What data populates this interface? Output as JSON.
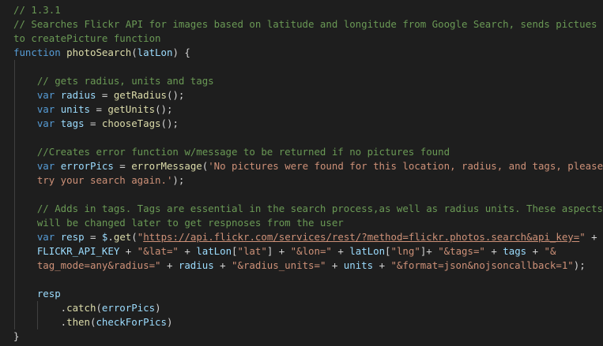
{
  "editor": {
    "lines": [
      {
        "tokens": [
          {
            "t": "cm",
            "v": "// 1.3.1"
          }
        ]
      },
      {
        "tokens": [
          {
            "t": "cm",
            "v": "// Searches Flickr API for images based on latitude and longitude from Google Search, sends pictues"
          }
        ]
      },
      {
        "tokens": [
          {
            "t": "cm",
            "v": "to createPicture function"
          }
        ]
      },
      {
        "tokens": [
          {
            "t": "kw",
            "v": "function "
          },
          {
            "t": "fn",
            "v": "photoSearch"
          },
          {
            "t": "pn",
            "v": "("
          },
          {
            "t": "vr",
            "v": "latLon"
          },
          {
            "t": "pn",
            "v": ") {"
          }
        ]
      },
      {
        "guides": 1,
        "tokens": []
      },
      {
        "guides": 1,
        "tokens": [
          {
            "t": "pn",
            "v": "    "
          },
          {
            "t": "cm",
            "v": "// gets radius, units and tags"
          }
        ]
      },
      {
        "guides": 1,
        "tokens": [
          {
            "t": "pn",
            "v": "    "
          },
          {
            "t": "kw",
            "v": "var "
          },
          {
            "t": "vr",
            "v": "radius"
          },
          {
            "t": "pn",
            "v": " = "
          },
          {
            "t": "fn",
            "v": "getRadius"
          },
          {
            "t": "pn",
            "v": "();"
          }
        ]
      },
      {
        "guides": 1,
        "tokens": [
          {
            "t": "pn",
            "v": "    "
          },
          {
            "t": "kw",
            "v": "var "
          },
          {
            "t": "vr",
            "v": "units"
          },
          {
            "t": "pn",
            "v": " = "
          },
          {
            "t": "fn",
            "v": "getUnits"
          },
          {
            "t": "pn",
            "v": "();"
          }
        ]
      },
      {
        "guides": 1,
        "tokens": [
          {
            "t": "pn",
            "v": "    "
          },
          {
            "t": "kw",
            "v": "var "
          },
          {
            "t": "vr",
            "v": "tags"
          },
          {
            "t": "pn",
            "v": " = "
          },
          {
            "t": "fn",
            "v": "chooseTags"
          },
          {
            "t": "pn",
            "v": "();"
          }
        ]
      },
      {
        "guides": 1,
        "tokens": []
      },
      {
        "guides": 1,
        "tokens": [
          {
            "t": "pn",
            "v": "    "
          },
          {
            "t": "cm",
            "v": "//Creates error function w/message to be returned if no pictures found"
          }
        ]
      },
      {
        "guides": 1,
        "tokens": [
          {
            "t": "pn",
            "v": "    "
          },
          {
            "t": "kw",
            "v": "var "
          },
          {
            "t": "vr",
            "v": "errorPics"
          },
          {
            "t": "pn",
            "v": " = "
          },
          {
            "t": "fn",
            "v": "errorMessage"
          },
          {
            "t": "pn",
            "v": "("
          },
          {
            "t": "st",
            "v": "'No pictures were found for this location, radius, and tags, please"
          }
        ]
      },
      {
        "guides": 1,
        "tokens": [
          {
            "t": "pn",
            "v": "    "
          },
          {
            "t": "st",
            "v": "try your search again.'"
          },
          {
            "t": "pn",
            "v": ");"
          }
        ]
      },
      {
        "guides": 1,
        "tokens": []
      },
      {
        "guides": 1,
        "tokens": [
          {
            "t": "pn",
            "v": "    "
          },
          {
            "t": "cm",
            "v": "// Adds in tags. Tags are essential in the search process,as well as radius units. These aspects"
          }
        ]
      },
      {
        "guides": 1,
        "tokens": [
          {
            "t": "pn",
            "v": "    "
          },
          {
            "t": "cm",
            "v": "will be changed later to get respnoses from the user"
          }
        ]
      },
      {
        "guides": 1,
        "tokens": [
          {
            "t": "pn",
            "v": "    "
          },
          {
            "t": "kw",
            "v": "var "
          },
          {
            "t": "vr",
            "v": "resp"
          },
          {
            "t": "pn",
            "v": " = "
          },
          {
            "t": "vr",
            "v": "$"
          },
          {
            "t": "pn",
            "v": "."
          },
          {
            "t": "fn",
            "v": "get"
          },
          {
            "t": "pn",
            "v": "("
          },
          {
            "t": "st",
            "v": "\""
          },
          {
            "t": "stu",
            "v": "https://api.flickr.com/services/rest/?method=flickr.photos.search&api_key="
          },
          {
            "t": "st",
            "v": "\""
          },
          {
            "t": "pn",
            "v": " +"
          }
        ]
      },
      {
        "guides": 1,
        "tokens": [
          {
            "t": "pn",
            "v": "    "
          },
          {
            "t": "vr",
            "v": "FLICKR_API_KEY"
          },
          {
            "t": "pn",
            "v": " + "
          },
          {
            "t": "st",
            "v": "\"&lat=\""
          },
          {
            "t": "pn",
            "v": " + "
          },
          {
            "t": "vr",
            "v": "latLon"
          },
          {
            "t": "pn",
            "v": "["
          },
          {
            "t": "st",
            "v": "\"lat\""
          },
          {
            "t": "pn",
            "v": "] + "
          },
          {
            "t": "st",
            "v": "\"&lon=\""
          },
          {
            "t": "pn",
            "v": " + "
          },
          {
            "t": "vr",
            "v": "latLon"
          },
          {
            "t": "pn",
            "v": "["
          },
          {
            "t": "st",
            "v": "\"lng\""
          },
          {
            "t": "pn",
            "v": "]+ "
          },
          {
            "t": "st",
            "v": "\"&tags=\""
          },
          {
            "t": "pn",
            "v": " + "
          },
          {
            "t": "vr",
            "v": "tags"
          },
          {
            "t": "pn",
            "v": " + "
          },
          {
            "t": "st",
            "v": "\"&"
          }
        ]
      },
      {
        "guides": 1,
        "tokens": [
          {
            "t": "pn",
            "v": "    "
          },
          {
            "t": "st",
            "v": "tag_mode=any&radius=\""
          },
          {
            "t": "pn",
            "v": " + "
          },
          {
            "t": "vr",
            "v": "radius"
          },
          {
            "t": "pn",
            "v": " + "
          },
          {
            "t": "st",
            "v": "\"&radius_units=\""
          },
          {
            "t": "pn",
            "v": " + "
          },
          {
            "t": "vr",
            "v": "units"
          },
          {
            "t": "pn",
            "v": " + "
          },
          {
            "t": "st",
            "v": "\"&format=json&nojsoncallback=1\""
          },
          {
            "t": "pn",
            "v": ");"
          }
        ]
      },
      {
        "guides": 1,
        "tokens": []
      },
      {
        "guides": 1,
        "tokens": [
          {
            "t": "pn",
            "v": "    "
          },
          {
            "t": "vr",
            "v": "resp"
          }
        ]
      },
      {
        "guides": 2,
        "tokens": [
          {
            "t": "pn",
            "v": "        ."
          },
          {
            "t": "fn",
            "v": "catch"
          },
          {
            "t": "pn",
            "v": "("
          },
          {
            "t": "vr",
            "v": "errorPics"
          },
          {
            "t": "pn",
            "v": ")"
          }
        ]
      },
      {
        "guides": 2,
        "tokens": [
          {
            "t": "pn",
            "v": "        ."
          },
          {
            "t": "fn",
            "v": "then"
          },
          {
            "t": "pn",
            "v": "("
          },
          {
            "t": "vr",
            "v": "checkForPics"
          },
          {
            "t": "pn",
            "v": ")"
          }
        ]
      },
      {
        "tokens": [
          {
            "t": "pn",
            "v": "}"
          }
        ]
      }
    ]
  }
}
